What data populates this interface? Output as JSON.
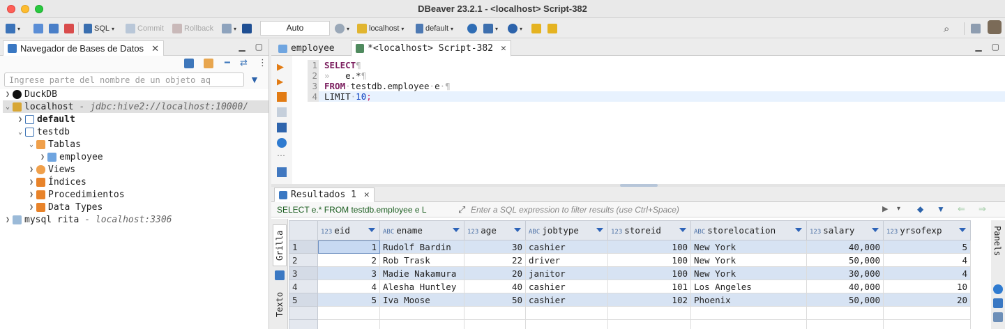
{
  "window": {
    "title": "DBeaver 23.2.1 - <localhost> Script-382"
  },
  "toolbar": {
    "sql_label": "SQL",
    "commit_label": "Commit",
    "rollback_label": "Rollback",
    "transaction_mode": "Auto",
    "datasource": "localhost",
    "schema": "default"
  },
  "navigator": {
    "title": "Navegador de Bases de Datos",
    "search_placeholder": "Ingrese parte del nombre de un objeto aq",
    "tree": [
      {
        "label": "DuckDB",
        "sub": ""
      },
      {
        "label": "localhost",
        "sub": "- jdbc:hive2://localhost:10000/"
      },
      {
        "label": "default",
        "sub": ""
      },
      {
        "label": "testdb",
        "sub": ""
      },
      {
        "label": "Tablas",
        "sub": ""
      },
      {
        "label": "employee",
        "sub": ""
      },
      {
        "label": "Views",
        "sub": ""
      },
      {
        "label": "Índices",
        "sub": ""
      },
      {
        "label": "Procedimientos",
        "sub": ""
      },
      {
        "label": "Data Types",
        "sub": ""
      },
      {
        "label": "mysql rita",
        "sub": "- localhost:3306"
      }
    ]
  },
  "editor": {
    "tabs": [
      {
        "label": "employee"
      },
      {
        "label": "*<localhost> Script-382"
      }
    ],
    "line_numbers": [
      "1",
      "2",
      "3",
      "4"
    ]
  },
  "results": {
    "tab_label": "Resultados 1",
    "filter_query": "SELECT e.* FROM testdb.employee e L",
    "filter_placeholder": "Enter a SQL expression to filter results (use Ctrl+Space)",
    "vtab_grid": "Grilla",
    "vtab_text": "Texto",
    "panels_label": "Panels",
    "columns": [
      {
        "name": "eid",
        "type": "123"
      },
      {
        "name": "ename",
        "type": "ABC"
      },
      {
        "name": "age",
        "type": "123"
      },
      {
        "name": "jobtype",
        "type": "ABC"
      },
      {
        "name": "storeid",
        "type": "123"
      },
      {
        "name": "storelocation",
        "type": "ABC"
      },
      {
        "name": "salary",
        "type": "123"
      },
      {
        "name": "yrsofexp",
        "type": "123"
      }
    ],
    "rows": [
      [
        "1",
        "1",
        "Rudolf Bardin",
        "30",
        "cashier",
        "100",
        "New York",
        "40,000",
        "5"
      ],
      [
        "2",
        "2",
        "Rob Trask",
        "22",
        "driver",
        "100",
        "New York",
        "50,000",
        "4"
      ],
      [
        "3",
        "3",
        "Madie Nakamura",
        "20",
        "janitor",
        "100",
        "New York",
        "30,000",
        "4"
      ],
      [
        "4",
        "4",
        "Alesha Huntley",
        "40",
        "cashier",
        "101",
        "Los Angeles",
        "40,000",
        "10"
      ],
      [
        "5",
        "5",
        "Iva Moose",
        "50",
        "cashier",
        "102",
        "Phoenix",
        "50,000",
        "20"
      ]
    ]
  },
  "colors": {
    "keyword": "#7b1e5e",
    "number": "#0a3fbf",
    "row_alt": "#d7e3f3",
    "header": "#e4e8ef"
  }
}
